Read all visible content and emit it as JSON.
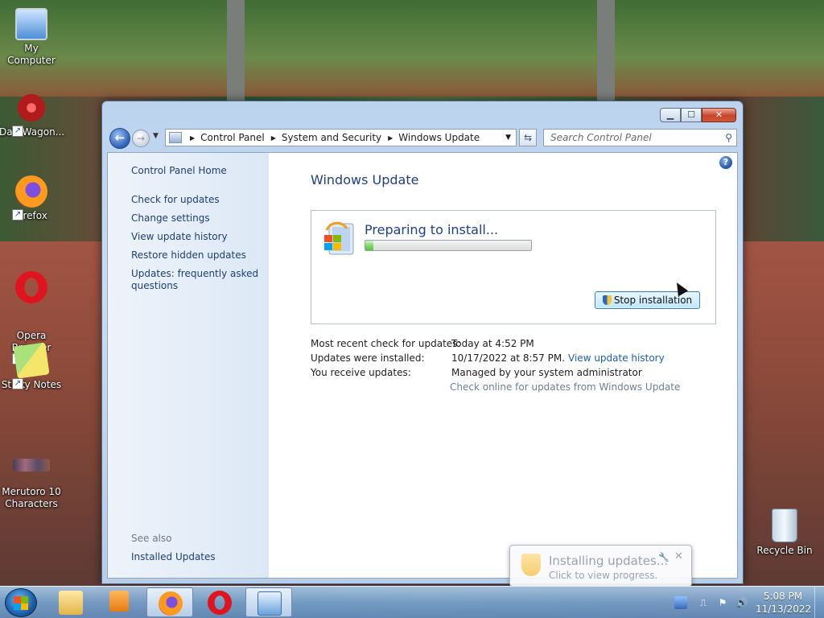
{
  "desktop": {
    "icons": [
      {
        "label": "My Computer",
        "icon": "computer-icon"
      },
      {
        "label": "DataWagon...",
        "icon": "datawagon-icon"
      },
      {
        "label": "Firefox",
        "icon": "firefox-icon"
      },
      {
        "label": "Opera\nBrowser",
        "icon": "opera-icon"
      },
      {
        "label": "Sticky Notes",
        "icon": "sticky-notes-icon"
      },
      {
        "label": "Merutoro 10\nCharacters",
        "icon": "merutoro-icon"
      },
      {
        "label": "Recycle Bin",
        "icon": "recycle-bin-icon"
      }
    ]
  },
  "window": {
    "controls": {
      "minimize": "▁",
      "maximize": "☐",
      "close": "✕"
    },
    "breadcrumb": [
      "Control Panel",
      "System and Security",
      "Windows Update"
    ],
    "search_placeholder": "Search Control Panel",
    "help": "?"
  },
  "sidebar": {
    "home": "Control Panel Home",
    "links": [
      "Check for updates",
      "Change settings",
      "View update history",
      "Restore hidden updates",
      "Updates: frequently asked\nquestions"
    ],
    "see_also_label": "See also",
    "see_also_links": [
      "Installed Updates"
    ]
  },
  "main": {
    "title": "Windows Update",
    "status_text": "Preparing to install...",
    "progress_fraction": 0.05,
    "stop_button": "Stop installation",
    "info": [
      {
        "label": "Most recent check for updates:",
        "value": "Today at 4:52 PM",
        "link": ""
      },
      {
        "label": "Updates were installed:",
        "value": "10/17/2022 at 8:57 PM.",
        "link": "View update history"
      },
      {
        "label": "You receive updates:",
        "value": "Managed by your system administrator",
        "link": ""
      }
    ],
    "check_online": "Check online for updates from Windows Update"
  },
  "notification": {
    "title": "Installing updates...",
    "subtitle": "Click to view progress."
  },
  "taskbar": {
    "items": [
      "explorer-icon",
      "media-player-icon",
      "firefox-icon",
      "opera-icon",
      "control-panel-icon"
    ],
    "clock_time": "5:08 PM",
    "clock_date": "11/13/2022"
  },
  "colors": {
    "accent": "#1e3f8a",
    "link": "#1a5fb4",
    "progress": "#59c443"
  }
}
